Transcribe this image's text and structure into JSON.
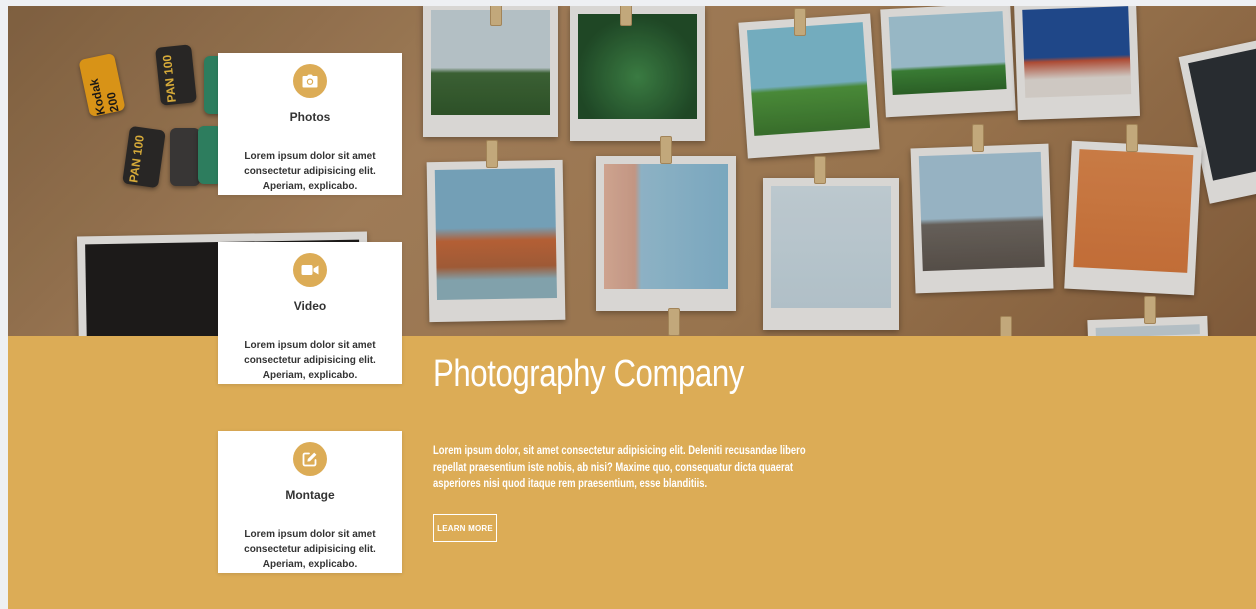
{
  "colors": {
    "accent": "#dcac56",
    "card_bg": "#ffffff",
    "text_light": "#ffffff",
    "text_dark": "#333333"
  },
  "services": [
    {
      "icon": "camera-icon",
      "title": "Photos",
      "text": "Lorem ipsum dolor sit amet consectetur adipisicing elit. Aperiam, explicabo."
    },
    {
      "icon": "video-camera-icon",
      "title": "Video",
      "text": "Lorem ipsum dolor sit amet consectetur adipisicing elit. Aperiam, explicabo."
    },
    {
      "icon": "edit-icon",
      "title": "Montage",
      "text": "Lorem ipsum dolor sit amet consectetur adipisicing elit. Aperiam, explicabo."
    }
  ],
  "main": {
    "title": "Photography Company",
    "text": "Lorem ipsum dolor, sit amet consectetur adipisicing elit. Deleniti recusandae libero repellat praesentium iste nobis, ab nisi? Maxime quo, consequatur dicta quaerat asperiores nisi quod itaque rem praesentium, esse blanditiis.",
    "button_label": "LEARN MORE"
  },
  "hero": {
    "film_labels": [
      "Kodak 200",
      "PAN 100",
      "PAN 100"
    ]
  }
}
